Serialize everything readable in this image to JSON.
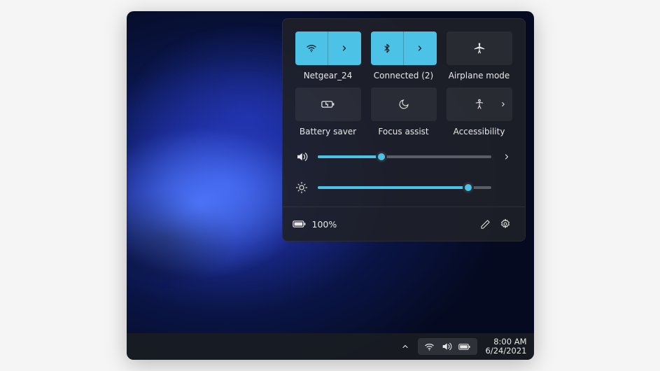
{
  "colors": {
    "accent": "#4cc2e6"
  },
  "tiles": [
    {
      "icon": "wifi-icon",
      "label": "Netgear_24",
      "active": true,
      "split": true
    },
    {
      "icon": "bluetooth-icon",
      "label": "Connected (2)",
      "active": true,
      "split": true
    },
    {
      "icon": "airplane-icon",
      "label": "Airplane mode",
      "active": false,
      "split": false
    },
    {
      "icon": "battery-saver-icon",
      "label": "Battery saver",
      "active": false,
      "split": false
    },
    {
      "icon": "moon-icon",
      "label": "Focus assist",
      "active": false,
      "split": false
    },
    {
      "icon": "accessibility-icon",
      "label": "Accessibility",
      "active": false,
      "split": false,
      "chevron": true
    }
  ],
  "sliders": {
    "volume": {
      "percent": 37
    },
    "brightness": {
      "percent": 87
    }
  },
  "footer": {
    "battery_text": "100%"
  },
  "taskbar": {
    "time": "8:00 AM",
    "date": "6/24/2021"
  }
}
